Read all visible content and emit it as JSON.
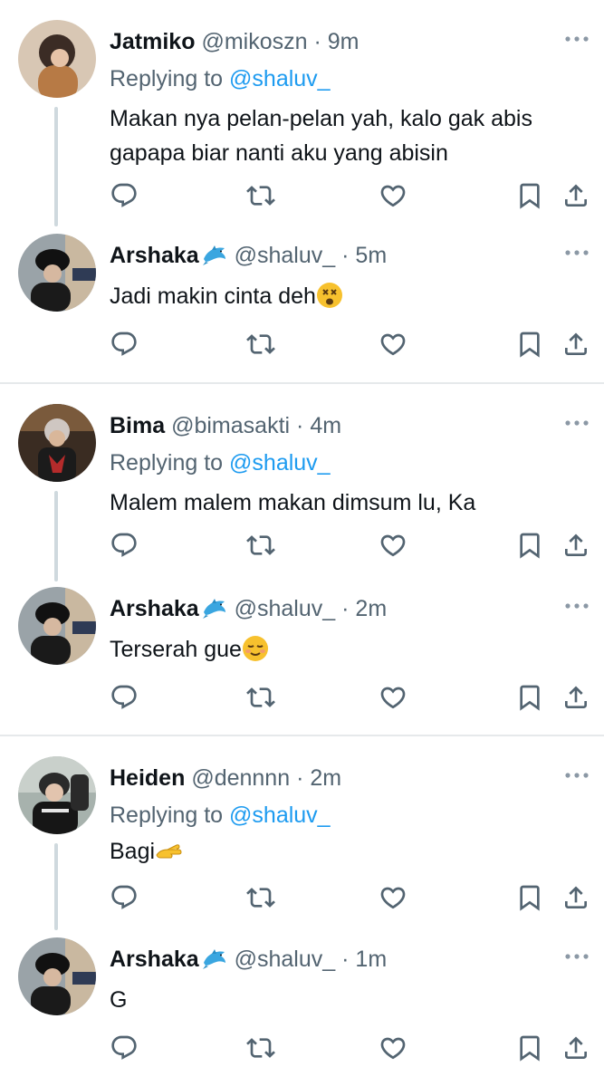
{
  "reply_prefix": "Replying to",
  "colors": {
    "accent": "#1d9bf0",
    "muted": "#536471",
    "text": "#0f1419",
    "line": "#cfd9de"
  },
  "icons": [
    "reply-icon",
    "retweet-icon",
    "like-icon",
    "bookmark-icon",
    "share-icon",
    "more-icon"
  ],
  "threads": [
    {
      "reply": {
        "name": "Jatmiko",
        "handle": "@mikoszn",
        "dot": "·",
        "time": "9m",
        "reply_to": "@shaluv_",
        "text_lines": [
          "Makan nya pelan-pelan yah, kalo gak abis",
          "gapapa biar nanti aku yang abisin"
        ]
      },
      "author_reply": {
        "name": "Arshaka",
        "handle": "@shaluv_",
        "dot": "·",
        "time": "5m",
        "text": "Jadi makin cinta deh",
        "emoji": "dizzy-face-emoji"
      }
    },
    {
      "reply": {
        "name": "Bima",
        "handle": "@bimasakti",
        "dot": "·",
        "time": "4m",
        "reply_to": "@shaluv_",
        "text_lines": [
          "Malem malem makan dimsum lu, Ka"
        ]
      },
      "author_reply": {
        "name": "Arshaka",
        "handle": "@shaluv_",
        "dot": "·",
        "time": "2m",
        "text": "Terserah gue",
        "emoji": "relieved-face-emoji"
      }
    },
    {
      "reply": {
        "name": "Heiden",
        "handle": "@dennnn",
        "dot": "·",
        "time": "2m",
        "reply_to": "@shaluv_",
        "text_lines": [
          "Bagi"
        ],
        "emoji": "palm-up-hand-emoji"
      },
      "author_reply": {
        "name": "Arshaka",
        "handle": "@shaluv_",
        "dot": "·",
        "time": "1m",
        "text": "G"
      }
    }
  ]
}
